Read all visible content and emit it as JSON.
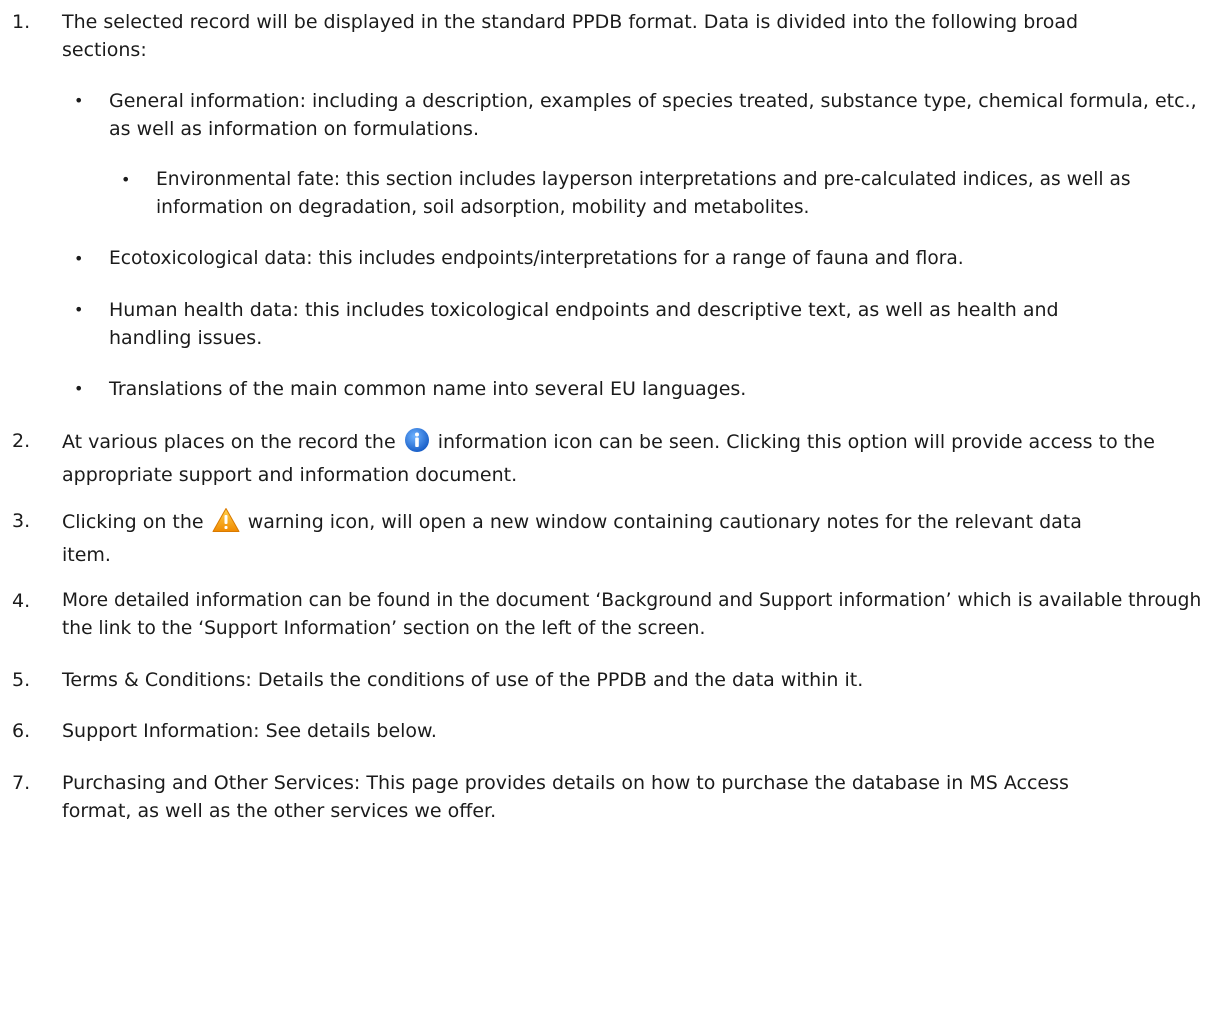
{
  "items": [
    {
      "num": "1.",
      "text": "The selected record will be displayed in the standard PPDB format. Data is divided into the following broad sections:"
    },
    {
      "num": "2.",
      "before": "At various places on the record the",
      "icon": "info-icon",
      "after": "information icon can be seen. Clicking this option will provide access to the appropriate support and information document."
    },
    {
      "num": "3.",
      "before": "Clicking on the",
      "icon": "warning-icon",
      "after": "warning icon, will open a new window containing cautionary notes for the relevant data item."
    },
    {
      "num": "4.",
      "text": "More detailed information can be found in the document ‘Background and Support information’ which is available through the link to the ‘Support Information’ section on the left of the screen."
    },
    {
      "num": "5.",
      "text": "Terms & Conditions: Details the conditions of use of the PPDB and the data within it."
    },
    {
      "num": "6.",
      "text": "Support Information: See details below."
    },
    {
      "num": "7.",
      "text": "Purchasing and Other Services: This page provides details on how to purchase the database in MS Access format, as well as the other services we offer."
    }
  ],
  "bullets": [
    "General information: including a description, examples of species treated, substance type, chemical formula, etc., as well as information on formulations.",
    "Environmental fate: this section includes layperson interpretations and pre-calculated indices, as well as information on degradation, soil adsorption, mobility and metabolites.",
    "Ecotoxicological data: this includes endpoints/interpretations for a range of fauna and flora.",
    "Human health data: this includes toxicological endpoints and descriptive text, as well as health and handling issues.",
    "Translations of the main common name into several EU languages."
  ],
  "bullet_glyph": "•",
  "colors": {
    "text": "#1b1b1b",
    "info_icon": "#1e6fd9",
    "warning_icon": "#f5a623"
  }
}
